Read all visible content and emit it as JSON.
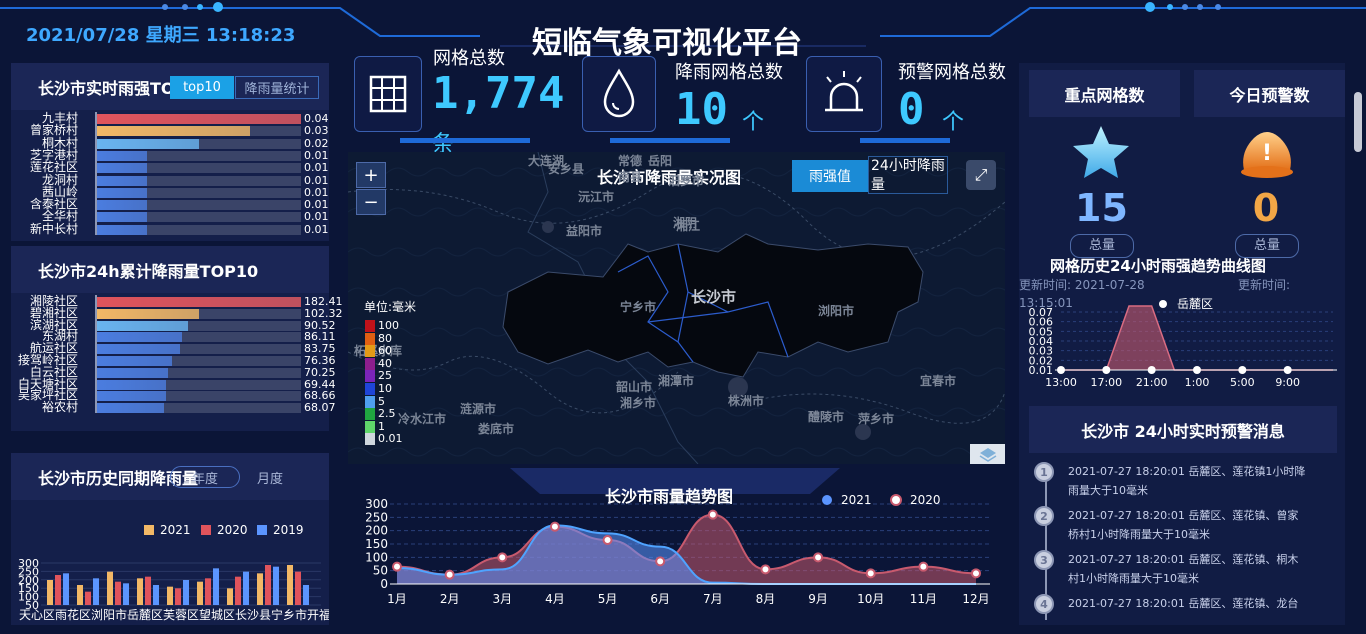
{
  "header": {
    "datetime": "2021/07/28 星期三 13:18:23",
    "title": "短临气象可视化平台"
  },
  "stats": [
    {
      "label": "网格总数",
      "value": "1,774",
      "unit": "条",
      "icon": "grid-icon"
    },
    {
      "label": "降雨网格总数",
      "value": "10",
      "unit": "个",
      "icon": "raindrop-icon"
    },
    {
      "label": "预警网格总数",
      "value": "0",
      "unit": "个",
      "icon": "alarm-light-icon"
    }
  ],
  "realtime_rain": {
    "title": "长沙市实时雨强TOP10",
    "tabs": [
      "top10",
      "降雨量统计"
    ],
    "rows": [
      {
        "name": "九丰村",
        "value": "0.04",
        "ratio": 1.0,
        "color": "#e0545c"
      },
      {
        "name": "曾家桥村",
        "value": "0.03",
        "ratio": 0.75,
        "color": "#f2b866"
      },
      {
        "name": "桐木村",
        "value": "0.02",
        "ratio": 0.5,
        "color": "#69b4f0"
      },
      {
        "name": "芝字港村",
        "value": "0.01",
        "ratio": 0.25,
        "color": "#4b7de0"
      },
      {
        "name": "莲花社区",
        "value": "0.01",
        "ratio": 0.25,
        "color": "#4b7de0"
      },
      {
        "name": "龙洞村",
        "value": "0.01",
        "ratio": 0.25,
        "color": "#4b7de0"
      },
      {
        "name": "茜山岭",
        "value": "0.01",
        "ratio": 0.25,
        "color": "#4b7de0"
      },
      {
        "name": "含泰社区",
        "value": "0.01",
        "ratio": 0.25,
        "color": "#4b7de0"
      },
      {
        "name": "全华村",
        "value": "0.01",
        "ratio": 0.25,
        "color": "#4b7de0"
      },
      {
        "name": "新中长村",
        "value": "0.01",
        "ratio": 0.25,
        "color": "#4b7de0"
      }
    ]
  },
  "cumulative_rain": {
    "title": "长沙市24h累计降雨量TOP10",
    "rows": [
      {
        "name": "湘陵社区",
        "value": "182.41",
        "ratio": 1.0,
        "color": "#e0545c"
      },
      {
        "name": "碧湘社区",
        "value": "102.32",
        "ratio": 0.5,
        "color": "#f2b866"
      },
      {
        "name": "滨湖社区",
        "value": "90.52",
        "ratio": 0.45,
        "color": "#69b4f0"
      },
      {
        "name": "东湖村",
        "value": "86.11",
        "ratio": 0.42,
        "color": "#4b7de0"
      },
      {
        "name": "航运社区",
        "value": "83.75",
        "ratio": 0.41,
        "color": "#4b7de0"
      },
      {
        "name": "接驾岭社区",
        "value": "76.36",
        "ratio": 0.37,
        "color": "#4b7de0"
      },
      {
        "name": "白云社区",
        "value": "70.25",
        "ratio": 0.35,
        "color": "#4b7de0"
      },
      {
        "name": "白天塘社区",
        "value": "69.44",
        "ratio": 0.34,
        "color": "#4b7de0"
      },
      {
        "name": "吴家坪社区",
        "value": "68.66",
        "ratio": 0.34,
        "color": "#4b7de0"
      },
      {
        "name": "裕农村",
        "value": "68.07",
        "ratio": 0.33,
        "color": "#4b7de0"
      }
    ]
  },
  "history_rain": {
    "title": "长沙市历史同期降雨量",
    "tabs": [
      "年度",
      "月度"
    ],
    "legend": [
      "2021",
      "2020",
      "2019"
    ],
    "colors": [
      "#f2b866",
      "#e0545c",
      "#5b95ff"
    ],
    "yticks": [
      "300",
      "250",
      "200",
      "150",
      "100",
      "50"
    ],
    "xlabels": "天心区雨花区浏阳市岳麓区芙蓉区望城区长沙县宁乡市开福区"
  },
  "map": {
    "title": "长沙市降雨量实况图",
    "tabs": [
      "雨强值",
      "24小时降雨量"
    ],
    "zoom_in": "+",
    "zoom_out": "−",
    "center_label": "长沙市",
    "places": [
      "大连湖",
      "安乡县",
      "常德",
      "沅江市",
      "南县",
      "汨罗市",
      "湘阴",
      "益阳市",
      "岳阳",
      "湘江",
      "宁乡市",
      "浏阳市",
      "韶山市",
      "湘潭市",
      "湘乡市",
      "株洲市",
      "醴陵市",
      "宜春市",
      "萍乡市",
      "冷水江市",
      "涟源市",
      "娄底市",
      "柘溪水库"
    ],
    "legend_title": "单位:毫米",
    "legend": [
      {
        "label": "100",
        "color": "#c0121a"
      },
      {
        "label": "80",
        "color": "#e05f12"
      },
      {
        "label": "60",
        "color": "#e49b17"
      },
      {
        "label": "40",
        "color": "#8d1e8d"
      },
      {
        "label": "25",
        "color": "#7a24b8"
      },
      {
        "label": "10",
        "color": "#1f45d8"
      },
      {
        "label": "5",
        "color": "#4fa0ef"
      },
      {
        "label": "2.5",
        "color": "#20a640"
      },
      {
        "label": "1",
        "color": "#5fd66a"
      },
      {
        "label": "0.01",
        "color": "#cfd7dd"
      }
    ]
  },
  "trend": {
    "title": "长沙市雨量趋势图",
    "legend": [
      "2021",
      "2020"
    ],
    "chart_data": {
      "type": "area",
      "title": "长沙市雨量趋势图",
      "categories": [
        "1月",
        "2月",
        "3月",
        "4月",
        "5月",
        "6月",
        "7月",
        "8月",
        "9月",
        "10月",
        "11月",
        "12月"
      ],
      "series": [
        {
          "name": "2021",
          "values": [
            60,
            35,
            55,
            220,
            190,
            140,
            5,
            0,
            0,
            0,
            0,
            0
          ],
          "color": "#5b95ff"
        },
        {
          "name": "2020",
          "values": [
            65,
            35,
            100,
            215,
            165,
            85,
            260,
            55,
            100,
            40,
            65,
            40
          ],
          "color": "#c85a6e"
        }
      ],
      "yticks": [
        "300",
        "250",
        "200",
        "150",
        "100",
        "50",
        "0"
      ],
      "ylim": [
        0,
        300
      ]
    }
  },
  "key_grid": {
    "title": "重点网格数",
    "value": "15",
    "sub": "总量"
  },
  "today_warning": {
    "title": "今日预警数",
    "value": "0",
    "sub": "总量"
  },
  "grid_history": {
    "title": "网格历史24小时雨强趋势曲线图",
    "update_left": "更新时间: 2021-07-28 13:15:01",
    "update_right": "更新时间:",
    "legend": "岳麓区",
    "chart_data": {
      "type": "area",
      "title": "网格历史24小时雨强趋势曲线图",
      "categories": [
        "13:00",
        "17:00",
        "21:00",
        "1:00",
        "5:00",
        "9:00"
      ],
      "series": [
        {
          "name": "岳麓区",
          "x": [
            "13:00",
            "15:00",
            "17:00",
            "18:00",
            "19:00",
            "21:00",
            "23:00",
            "1:00",
            "3:00",
            "5:00",
            "7:00",
            "9:00",
            "11:00"
          ],
          "values": [
            0,
            0,
            0,
            0.07,
            0.07,
            0,
            0,
            0,
            0,
            0,
            0,
            0,
            0
          ]
        }
      ],
      "yticks": [
        "0.07",
        "0.06",
        "0.05",
        "0.04",
        "0.03",
        "0.02",
        "0.01"
      ],
      "ylim": [
        0,
        0.07
      ]
    }
  },
  "warnings": {
    "title": "长沙市 24小时实时预警消息",
    "items": [
      {
        "num": "1",
        "text": "2021-07-27 18:20:01 岳麓区、莲花镇1小时降雨量大于10毫米"
      },
      {
        "num": "2",
        "text": "2021-07-27 18:20:01 岳麓区、莲花镇、曾家桥村1小时降雨量大于10毫米"
      },
      {
        "num": "3",
        "text": "2021-07-27 18:20:01 岳麓区、莲花镇、桐木村1小时降雨量大于10毫米"
      },
      {
        "num": "4",
        "text": "2021-07-27 18:20:01 岳麓区、莲花镇、龙台"
      }
    ]
  }
}
